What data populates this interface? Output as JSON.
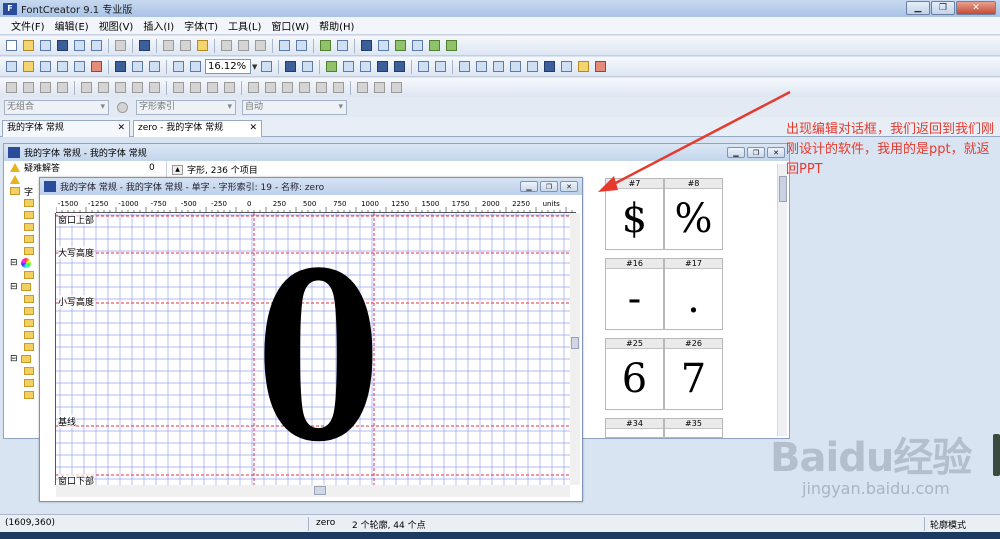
{
  "app": {
    "title": "FontCreator 9.1 专业版",
    "logo_text": "F"
  },
  "menu": [
    "文件(F)",
    "编辑(E)",
    "视图(V)",
    "插入(I)",
    "字体(T)",
    "工具(L)",
    "窗口(W)",
    "帮助(H)"
  ],
  "toolbar": {
    "zoom_value": "16.12%"
  },
  "combos": {
    "group": "无组合",
    "glyph_index": "字形索引",
    "auto": "自动"
  },
  "tabs": [
    {
      "label": "我的字体 常规"
    },
    {
      "label": "zero - 我的字体 常规"
    }
  ],
  "font_window": {
    "title": "我的字体 常规 - 我的字体 常规",
    "tree_top_item": "疑难解答",
    "tree_top_count": "0",
    "tree_folder_item": "字",
    "glyph_count_text": "字形, 236 个项目",
    "cells": [
      {
        "label": "#7",
        "glyph": "$"
      },
      {
        "label": "#8",
        "glyph": "%"
      },
      {
        "label": "#16",
        "glyph": "-"
      },
      {
        "label": "#17",
        "glyph": "."
      },
      {
        "label": "#25",
        "glyph": "6"
      },
      {
        "label": "#26",
        "glyph": "7"
      },
      {
        "label": "#34",
        "glyph": ""
      },
      {
        "label": "#35",
        "glyph": ""
      }
    ]
  },
  "glyph_window": {
    "title": "我的字体 常规 - 我的字体 常规 - 单字 - 字形索引: 19 - 名称: zero",
    "ruler_labels": [
      "-1500",
      "-1250",
      "-1000",
      "-750",
      "-500",
      "-250",
      "0",
      "250",
      "500",
      "750",
      "1000",
      "1250",
      "1500",
      "1750",
      "2000",
      "2250",
      "units"
    ],
    "metric_labels": {
      "win_ascent": "窗口上部",
      "cap_height": "大写高度",
      "x_height": "小写高度",
      "baseline": "基线",
      "win_descent": "窗口下部"
    },
    "glyph": "0"
  },
  "annotation": "出现编辑对话框，我们返回到我们刚刚设计的软件，我用的是ppt，就返回PPT",
  "watermark": {
    "brand": "Baidu经验",
    "url": "jingyan.baidu.com"
  },
  "status": {
    "coords": "(1609,360)",
    "glyph_name": "zero",
    "contours": "2 个轮廓, 44 个点",
    "mode": "轮廓模式"
  },
  "colors": {
    "annotation": "#e53b2f",
    "guide_red": "#e0304a",
    "grid_blue": "#9aa4f0"
  }
}
